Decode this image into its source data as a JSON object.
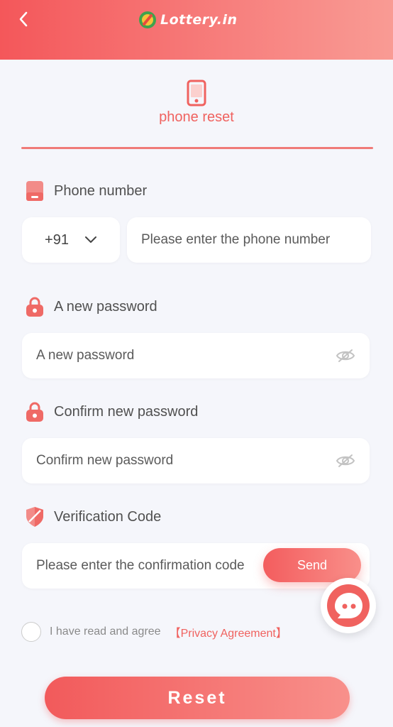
{
  "header": {
    "back_icon": "chevron-left-icon",
    "logo_text": "Lottery.in",
    "logo_icon": "lottery-logo-icon"
  },
  "tab": {
    "label": "phone reset",
    "icon": "phone-icon"
  },
  "phone": {
    "label": "Phone number",
    "country_code": "+91",
    "placeholder": "Please enter the phone number"
  },
  "new_password": {
    "label": "A new password",
    "placeholder": "A new password"
  },
  "confirm_password": {
    "label": "Confirm new password",
    "placeholder": "Confirm new password"
  },
  "verification": {
    "label": "Verification Code",
    "placeholder": "Please enter the confirmation code",
    "send_label": "Send"
  },
  "agreement": {
    "text": "I have read and agree",
    "link": "【Privacy Agreement】"
  },
  "reset_label": "Reset",
  "colors": {
    "accent": "#f0625f",
    "background": "#f5f6fb"
  }
}
